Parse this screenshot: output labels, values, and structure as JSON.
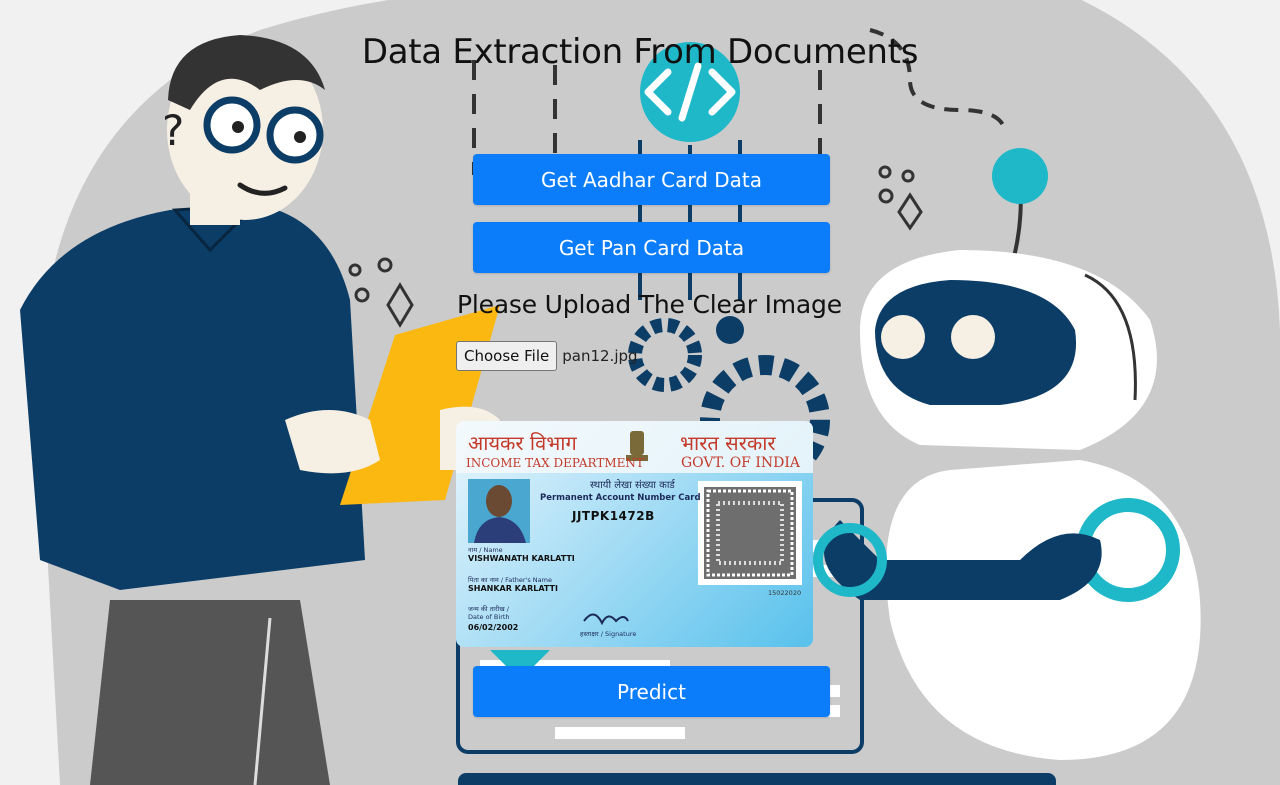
{
  "page": {
    "title": "Data Extraction From Documents"
  },
  "buttons": {
    "aadhar": "Get Aadhar Card Data",
    "pan": "Get Pan Card Data",
    "predict": "Predict"
  },
  "upload": {
    "label": "Please Upload The Clear Image",
    "choose_label": "Choose File",
    "file_name": "pan12.jpg"
  },
  "preview_card": {
    "hindi_dept": "आयकर विभाग",
    "hindi_govt": "भारत सरकार",
    "dept": "INCOME TAX DEPARTMENT",
    "govt": "GOVT. OF INDIA",
    "hindi_card_title": "स्थायी लेखा संख्या कार्ड",
    "card_title": "Permanent Account Number Card",
    "pan_number": "JJTPK1472B",
    "name_label": "नाम / Name",
    "name": "VISHWANATH KARLATTI",
    "father_label": "पिता का नाम / Father's Name",
    "father_name": "SHANKAR KARLATTI",
    "dob_label_hi": "जन्म की तारीख /",
    "dob_label": "Date of Birth",
    "dob": "06/02/2002",
    "signature_label": "हस्ताक्षर / Signature",
    "issue_code": "15022020"
  },
  "colors": {
    "button": "#0b7dfb",
    "navy": "#0c3d66",
    "teal": "#1fb8c9",
    "gray_blob": "#c9c9c9"
  },
  "icons": [
    "code-icon",
    "gear-icon",
    "qr-code-icon",
    "emblem-icon"
  ]
}
